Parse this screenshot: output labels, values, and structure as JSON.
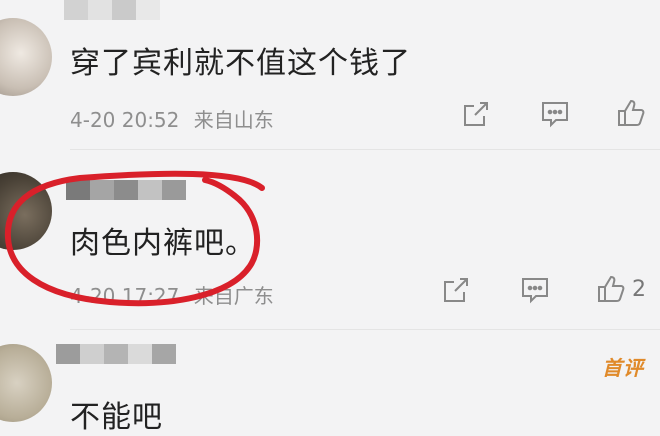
{
  "comments": [
    {
      "text": "穿了宾利就不值这个钱了",
      "date": "4-20 20:52",
      "location": "来自山东",
      "like_count": ""
    },
    {
      "text": "肉色内裤吧。",
      "date": "4-20 17:27",
      "location": "来自广东",
      "like_count": "2"
    },
    {
      "text": "不能吧",
      "date": "",
      "location": "",
      "like_count": ""
    }
  ],
  "watermark": "首评",
  "icons": {
    "share": "share-icon",
    "comment": "comment-icon",
    "like": "thumbs-up-icon"
  },
  "colors": {
    "circle_annotation": "#d9202a",
    "watermark": "#e08a2a",
    "meta_text": "#8e8e8e"
  }
}
